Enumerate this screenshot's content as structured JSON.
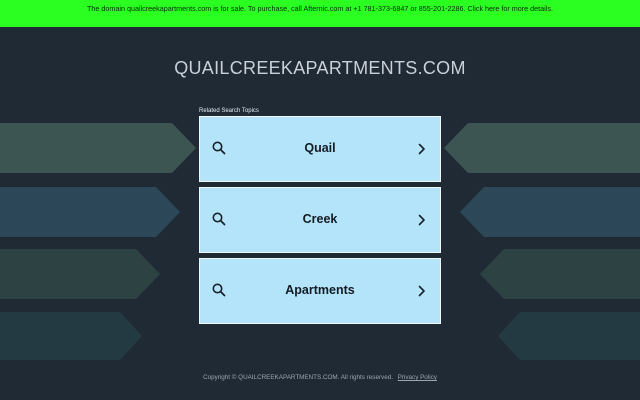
{
  "banner": {
    "text": "The domain quailcreekapartments.com is for sale. To purchase, call Afternic.com at +1 781-373-6847 or 855-201-2286. Click here for more details."
  },
  "header": {
    "domain": "QUAILCREEKAPARTMENTS.COM"
  },
  "related": {
    "label": "Related Search Topics",
    "topics": [
      {
        "label": "Quail"
      },
      {
        "label": "Creek"
      },
      {
        "label": "Apartments"
      }
    ]
  },
  "footer": {
    "copyright": "Copyright © QUAILCREEKAPARTMENTS.COM.  All rights reserved.",
    "privacy": "Privacy Policy"
  },
  "colors": {
    "background": "#1f2a35",
    "banner": "#2bff21",
    "card": "#b3e4fa",
    "arrow_1": "#3d5552",
    "arrow_2": "#2c4858",
    "arrow_3": "#2d4242",
    "arrow_4": "#243a42"
  },
  "icons": {
    "search": "search-icon",
    "chevron": "chevron-right-icon"
  }
}
